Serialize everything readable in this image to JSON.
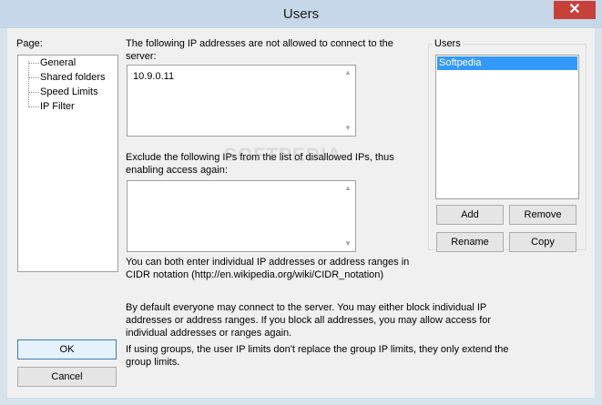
{
  "window": {
    "title": "Users",
    "close_glyph": "✕"
  },
  "page_panel": {
    "label": "Page:",
    "items": [
      {
        "label": "General"
      },
      {
        "label": "Shared folders"
      },
      {
        "label": "Speed Limits"
      },
      {
        "label": "IP Filter"
      }
    ]
  },
  "ip_filter": {
    "disallowed_label": "The following IP addresses are not allowed to connect to the server:",
    "disallowed_value": "10.9.0.11",
    "exclude_label": "Exclude the following IPs from the list of disallowed IPs, thus enabling access again:",
    "exclude_value": "",
    "hint_notation": "You can both enter individual IP addresses or address ranges in CIDR notation (http://en.wikipedia.org/wiki/CIDR_notation)",
    "hint_default": "By default everyone may connect to the server. You may either block individual IP addresses or address ranges. If you block all addresses, you may allow access for individual addresses or ranges again.",
    "hint_groups": "If using groups, the user IP limits don't replace the group IP limits, they only extend the group limits."
  },
  "users_panel": {
    "label": "Users",
    "items": [
      {
        "label": "Softpedia",
        "selected": true
      }
    ],
    "add_label": "Add",
    "remove_label": "Remove",
    "rename_label": "Rename",
    "copy_label": "Copy"
  },
  "dialog_buttons": {
    "ok_label": "OK",
    "cancel_label": "Cancel"
  },
  "watermark": "SOFTPEDIA",
  "colors": {
    "selection": "#3399ff",
    "close_button": "#c7413a",
    "title_bar": "#c5d7e8"
  }
}
